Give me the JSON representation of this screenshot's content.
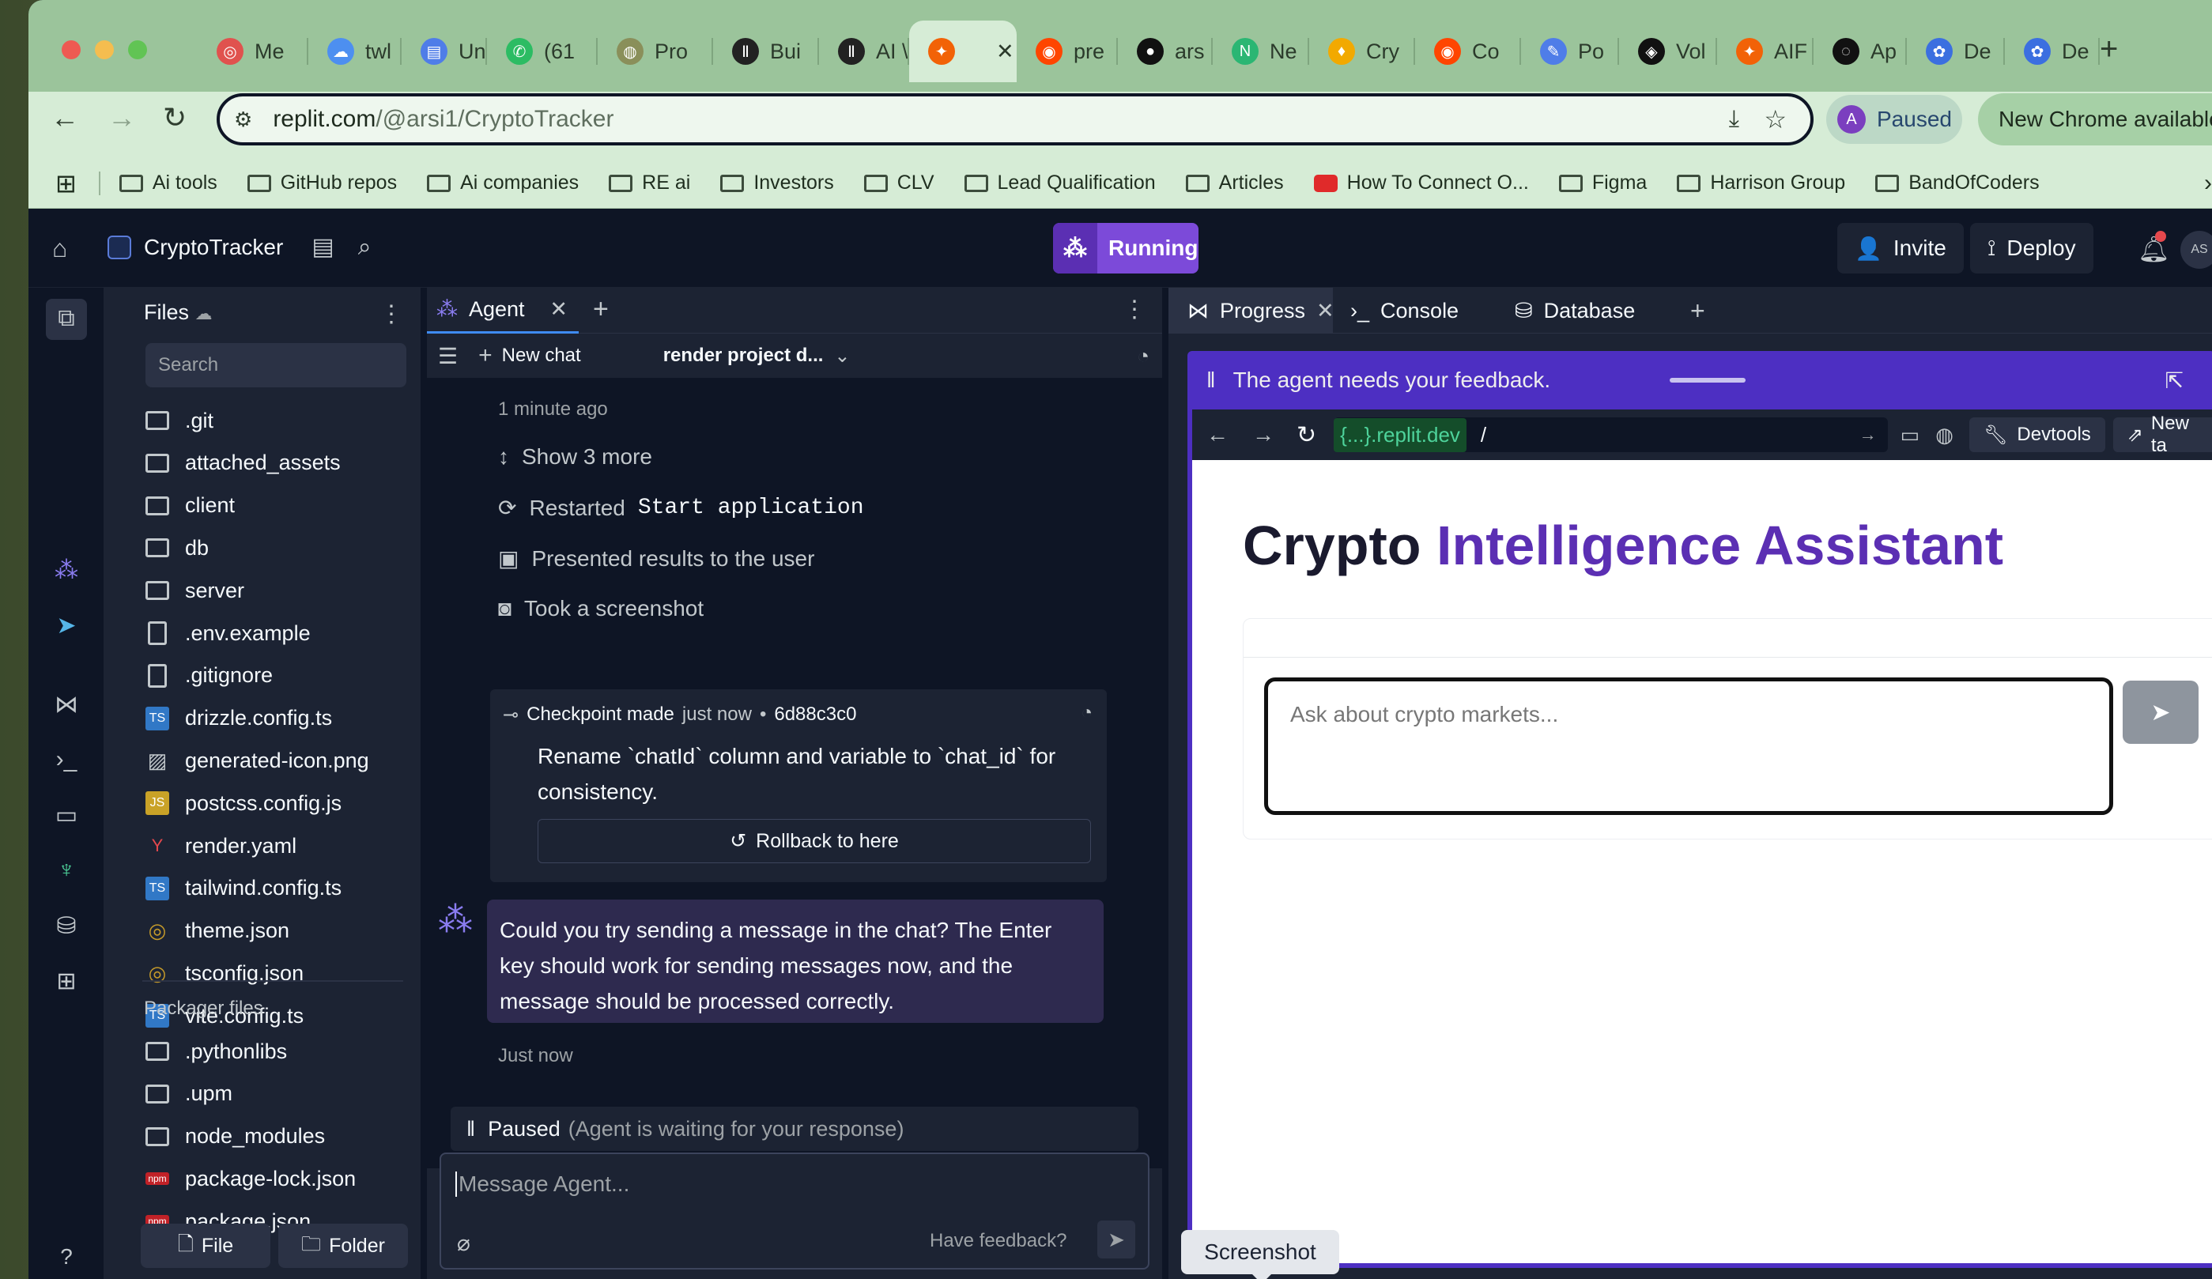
{
  "browser": {
    "tabs": [
      {
        "label": "Me",
        "fav": "#e0524e",
        "glyph": "◎"
      },
      {
        "label": "twl",
        "fav": "#4d8ff0",
        "glyph": "☁"
      },
      {
        "label": "Un",
        "fav": "#4f7de8",
        "glyph": "▤"
      },
      {
        "label": "(61",
        "fav": "#2cbc63",
        "glyph": "✆"
      },
      {
        "label": "Pro",
        "fav": "#8a8f5a",
        "glyph": "◍"
      },
      {
        "label": "Bui",
        "fav": "#222222",
        "glyph": "Ⅱ"
      },
      {
        "label": "AI \\",
        "fav": "#222222",
        "glyph": "Ⅱ"
      },
      {
        "label": "",
        "fav": "#f26207",
        "glyph": "✦",
        "active": true
      },
      {
        "label": "pre",
        "fav": "#ff4500",
        "glyph": "◉"
      },
      {
        "label": "ars",
        "fav": "#111111",
        "glyph": "●"
      },
      {
        "label": "Ne",
        "fav": "#2bb673",
        "glyph": "N"
      },
      {
        "label": "Cry",
        "fav": "#f2a900",
        "glyph": "♦"
      },
      {
        "label": "Co",
        "fav": "#ff4500",
        "glyph": "◉"
      },
      {
        "label": "Po",
        "fav": "#4f7de8",
        "glyph": "✎"
      },
      {
        "label": "Vol",
        "fav": "#111111",
        "glyph": "◈"
      },
      {
        "label": "AIF",
        "fav": "#f26207",
        "glyph": "✦"
      },
      {
        "label": "Ap",
        "fav": "#111111",
        "glyph": "◌"
      },
      {
        "label": "De",
        "fav": "#3b6fe0",
        "glyph": "✿"
      },
      {
        "label": "De",
        "fav": "#3b6fe0",
        "glyph": "✿"
      }
    ],
    "url_host": "replit.com",
    "url_path": "/@arsi1/CryptoTracker",
    "profile_initial": "A",
    "profile_status": "Paused",
    "update_label": "New Chrome available",
    "bookmarks": [
      "Ai tools",
      "GitHub repos",
      "Ai companies",
      "RE ai",
      "Investors",
      "CLV",
      "Lead Qualification",
      "Articles",
      "How To Connect O...",
      "Figma",
      "Harrison Group",
      "BandOfCoders"
    ]
  },
  "header": {
    "project": "CryptoTracker",
    "run_status": "Running",
    "invite": "Invite",
    "deploy": "Deploy",
    "avatar_initials": "AS"
  },
  "files": {
    "title": "Files",
    "search_placeholder": "Search",
    "items": [
      {
        "name": ".git",
        "type": "folder"
      },
      {
        "name": "attached_assets",
        "type": "folder"
      },
      {
        "name": "client",
        "type": "folder"
      },
      {
        "name": "db",
        "type": "folder"
      },
      {
        "name": "server",
        "type": "folder"
      },
      {
        "name": ".env.example",
        "type": "file"
      },
      {
        "name": ".gitignore",
        "type": "file"
      },
      {
        "name": "drizzle.config.ts",
        "type": "ts"
      },
      {
        "name": "generated-icon.png",
        "type": "image"
      },
      {
        "name": "postcss.config.js",
        "type": "js"
      },
      {
        "name": "render.yaml",
        "type": "yaml"
      },
      {
        "name": "tailwind.config.ts",
        "type": "ts"
      },
      {
        "name": "theme.json",
        "type": "json"
      },
      {
        "name": "tsconfig.json",
        "type": "json"
      },
      {
        "name": "vite.config.ts",
        "type": "ts"
      }
    ],
    "packager_title": "Packager files",
    "packager_items": [
      {
        "name": ".pythonlibs",
        "type": "folder"
      },
      {
        "name": ".upm",
        "type": "folder"
      },
      {
        "name": "node_modules",
        "type": "folder"
      },
      {
        "name": "package-lock.json",
        "type": "npm"
      },
      {
        "name": "package.json",
        "type": "npm"
      }
    ],
    "new_file": "File",
    "new_folder": "Folder"
  },
  "agent": {
    "tab": "Agent",
    "new_chat": "New chat",
    "chat_title": "render project d...",
    "time_ago": "1 minute ago",
    "show_more": "Show 3 more",
    "restarted_prefix": "Restarted",
    "restarted_cmd": "Start application",
    "presented": "Presented results to the user",
    "screenshot": "Took a screenshot",
    "checkpoint_label": "Checkpoint made",
    "checkpoint_time": "just now",
    "checkpoint_sep": "•",
    "checkpoint_hash": "6d88c3c0",
    "checkpoint_msg": "Rename `chatId` column and variable to `chat_id` for consistency.",
    "rollback": "Rollback to here",
    "message": "Could you try sending a message in the chat? The Enter key should work for sending messages now, and the message should be processed correctly.",
    "message_time": "Just now",
    "paused": "Paused",
    "paused_note": "(Agent is waiting for your response)",
    "input_placeholder": "Message Agent...",
    "feedback": "Have feedback?"
  },
  "preview": {
    "tabs": [
      "Progress",
      "Console",
      "Database"
    ],
    "feedback_banner": "The agent needs your feedback.",
    "host": "{...}.replit.dev",
    "path": "/",
    "devtools": "Devtools",
    "new_tab": "New ta",
    "heading_a": "Crypto",
    "heading_b": "Intelligence Assistant",
    "chat_placeholder": "Ask about crypto markets...",
    "tooltip": "Screenshot"
  }
}
